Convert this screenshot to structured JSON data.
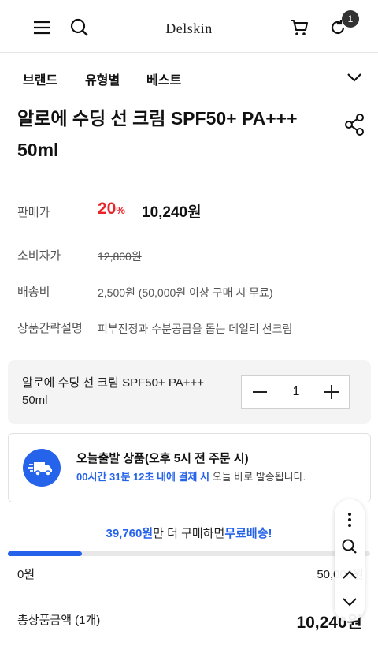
{
  "header": {
    "brand": "Delskin",
    "cart_count": "1",
    "icons": [
      "menu-icon",
      "search-icon",
      "cart-icon",
      "recent-view-icon"
    ]
  },
  "nav": {
    "categories": [
      "브랜드",
      "유형별",
      "베스트"
    ],
    "expand_icon": "chevron-down-icon"
  },
  "product": {
    "title": "알로에 수딩 선 크림 SPF50+ PA+++ 50ml",
    "sale_price_label": "판매가",
    "discount_value": "20",
    "discount_unit": "%",
    "sale_price": "10,240원",
    "consumer_price_label": "소비자가",
    "consumer_price": "12,800원",
    "shipping_label": "배송비",
    "shipping_value": "2,500원 (50,000원 이상 구매 시 무료)",
    "summary_label": "상품간략설명",
    "summary_value": "피부진정과 수분공급을 돕는 데일리 선크림"
  },
  "option": {
    "name": "알로에 수딩 선 크림 SPF50+ PA+++ 50ml",
    "quantity": "1"
  },
  "shipping_notice": {
    "title": "오늘출발 상품(오후 5시 전 주문 시)",
    "timer": "00시간 31분 12초 내에 결제 시",
    "suffix": " 오늘 바로 발송됩니다."
  },
  "free_shipping": {
    "amount": "39,760원",
    "middle": "만 더 구매하면",
    "highlight": "무료배송!",
    "progress": 0.2048,
    "min_label": "0원",
    "max_label": "50,000원"
  },
  "total": {
    "label": "총상품금액 (1개)",
    "value": "10,240원"
  },
  "colors": {
    "accent": "#2563eb",
    "discount": "#e8242b"
  }
}
